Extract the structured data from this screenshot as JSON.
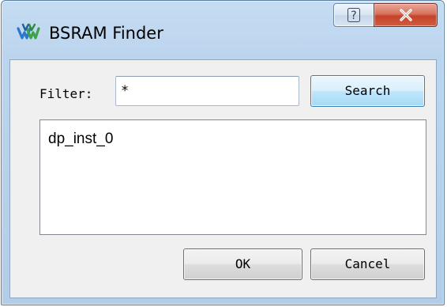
{
  "window": {
    "title": "BSRAM Finder",
    "icon": "app-logo-icon",
    "help_label": "?",
    "close_label": "X"
  },
  "filter": {
    "label": "Filter:",
    "value": "*"
  },
  "buttons": {
    "search_label": "Search",
    "ok_label": "OK",
    "cancel_label": "Cancel"
  },
  "results": {
    "items": [
      {
        "label": "dp_inst_0"
      }
    ]
  },
  "colors": {
    "titlebar": "#bcd5ee",
    "close_button": "#c4432b",
    "client_background": "#f0f0f0",
    "search_button_border": "#3c7fb1"
  }
}
